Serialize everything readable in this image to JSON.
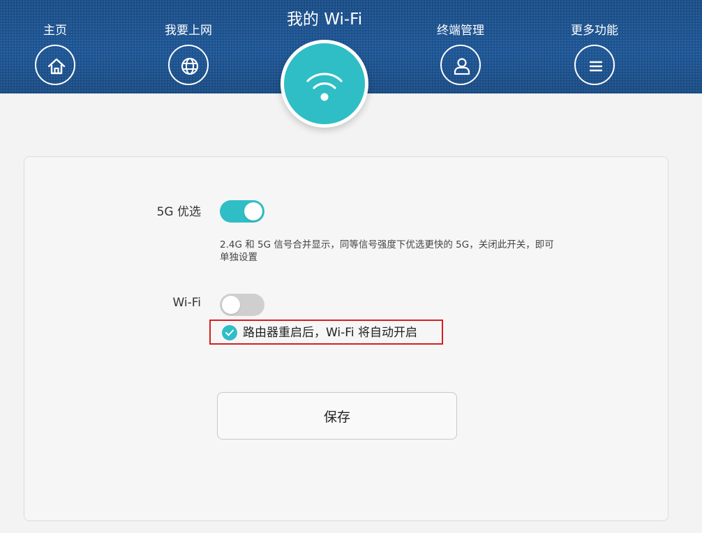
{
  "nav": {
    "items": [
      {
        "label": "主页",
        "icon": "home-icon"
      },
      {
        "label": "我要上网",
        "icon": "globe-icon"
      },
      {
        "label": "终端管理",
        "icon": "user-icon"
      },
      {
        "label": "更多功能",
        "icon": "menu-icon"
      }
    ],
    "active": {
      "label": "我的 Wi-Fi",
      "icon": "wifi-icon"
    }
  },
  "settings": {
    "band_steering": {
      "label": "5G 优选",
      "enabled": true,
      "description": "2.4G 和 5G 信号合并显示，同等信号强度下优选更快的 5G，关闭此开关，即可单独设置"
    },
    "wifi": {
      "label": "Wi-Fi",
      "enabled": false,
      "auto_enable_checked": true,
      "auto_enable_text": "路由器重启后，Wi-Fi 将自动开启"
    }
  },
  "actions": {
    "save_label": "保存"
  },
  "colors": {
    "header_blue": "#1b4f8a",
    "accent_teal": "#2fbec5",
    "highlight_red": "#d81e1e",
    "toggle_off": "#cfcfcf"
  }
}
